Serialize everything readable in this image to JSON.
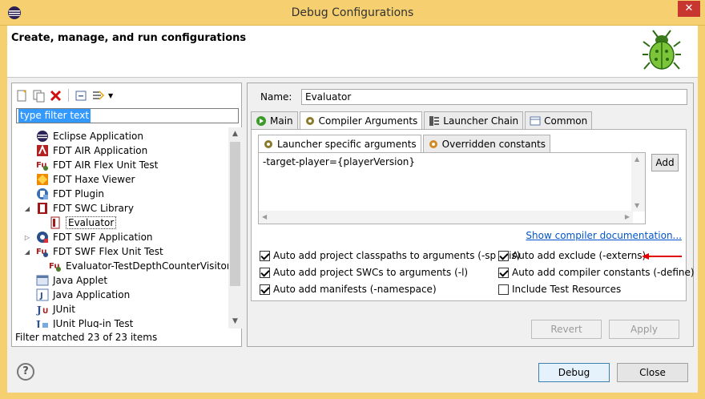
{
  "window": {
    "title": "Debug Configurations"
  },
  "banner": {
    "heading": "Create, manage, and run configurations"
  },
  "filter": {
    "placeholder": "type filter text"
  },
  "tree": [
    {
      "label": "Eclipse Application",
      "icon": "eclipse-icon"
    },
    {
      "label": "FDT AIR Application",
      "icon": "fdt-air-icon"
    },
    {
      "label": "FDT AIR Flex Unit Test",
      "icon": "flexunit-icon"
    },
    {
      "label": "FDT Haxe Viewer",
      "icon": "fdt-haxe-icon"
    },
    {
      "label": "FDT Plugin",
      "icon": "fdt-plugin-icon"
    },
    {
      "label": "FDT SWC Library",
      "icon": "swc-library-icon",
      "expanded": true
    },
    {
      "label": "Evaluator",
      "icon": "swc-config-icon",
      "child": true,
      "selected": true
    },
    {
      "label": "FDT SWF Application",
      "icon": "swf-app-icon",
      "collapsed": true
    },
    {
      "label": "FDT SWF Flex Unit Test",
      "icon": "swf-flexunit-icon",
      "expanded": true
    },
    {
      "label": "Evaluator-TestDepthCounterVisitor",
      "icon": "flexunit-icon",
      "child": true
    },
    {
      "label": "Java Applet",
      "icon": "java-applet-icon"
    },
    {
      "label": "Java Application",
      "icon": "java-app-icon"
    },
    {
      "label": "JUnit",
      "icon": "junit-icon"
    },
    {
      "label": "JUnit Plug-in Test",
      "icon": "junit-plugin-icon"
    }
  ],
  "filter_status": "Filter matched 23 of 23 items",
  "config": {
    "name_label": "Name:",
    "name_value": "Evaluator",
    "tabs": [
      "Main",
      "Compiler Arguments",
      "Launcher Chain",
      "Common"
    ],
    "subtabs": [
      "Launcher specific arguments",
      "Overridden constants"
    ],
    "arguments": "-target-player={playerVersion}",
    "add_label": "Add",
    "docs_link": "Show compiler documentation...",
    "checks": [
      {
        "label": "Auto add project classpaths to arguments (-sp / -is)",
        "checked": true
      },
      {
        "label": "Auto add exclude (-externs)",
        "checked": true
      },
      {
        "label": "Auto add project SWCs to arguments (-l)",
        "checked": true
      },
      {
        "label": "Auto add compiler constants (-define)",
        "checked": true
      },
      {
        "label": "Auto add manifests (-namespace)",
        "checked": true
      },
      {
        "label": "Include Test Resources",
        "checked": false
      }
    ],
    "revert_label": "Revert",
    "apply_label": "Apply"
  },
  "buttons": {
    "debug": "Debug",
    "close": "Close",
    "help": "?"
  },
  "colors": {
    "frame": "#f5cf70",
    "accent": "#3399ff",
    "link": "#0055cc",
    "arrow": "#e00000"
  }
}
